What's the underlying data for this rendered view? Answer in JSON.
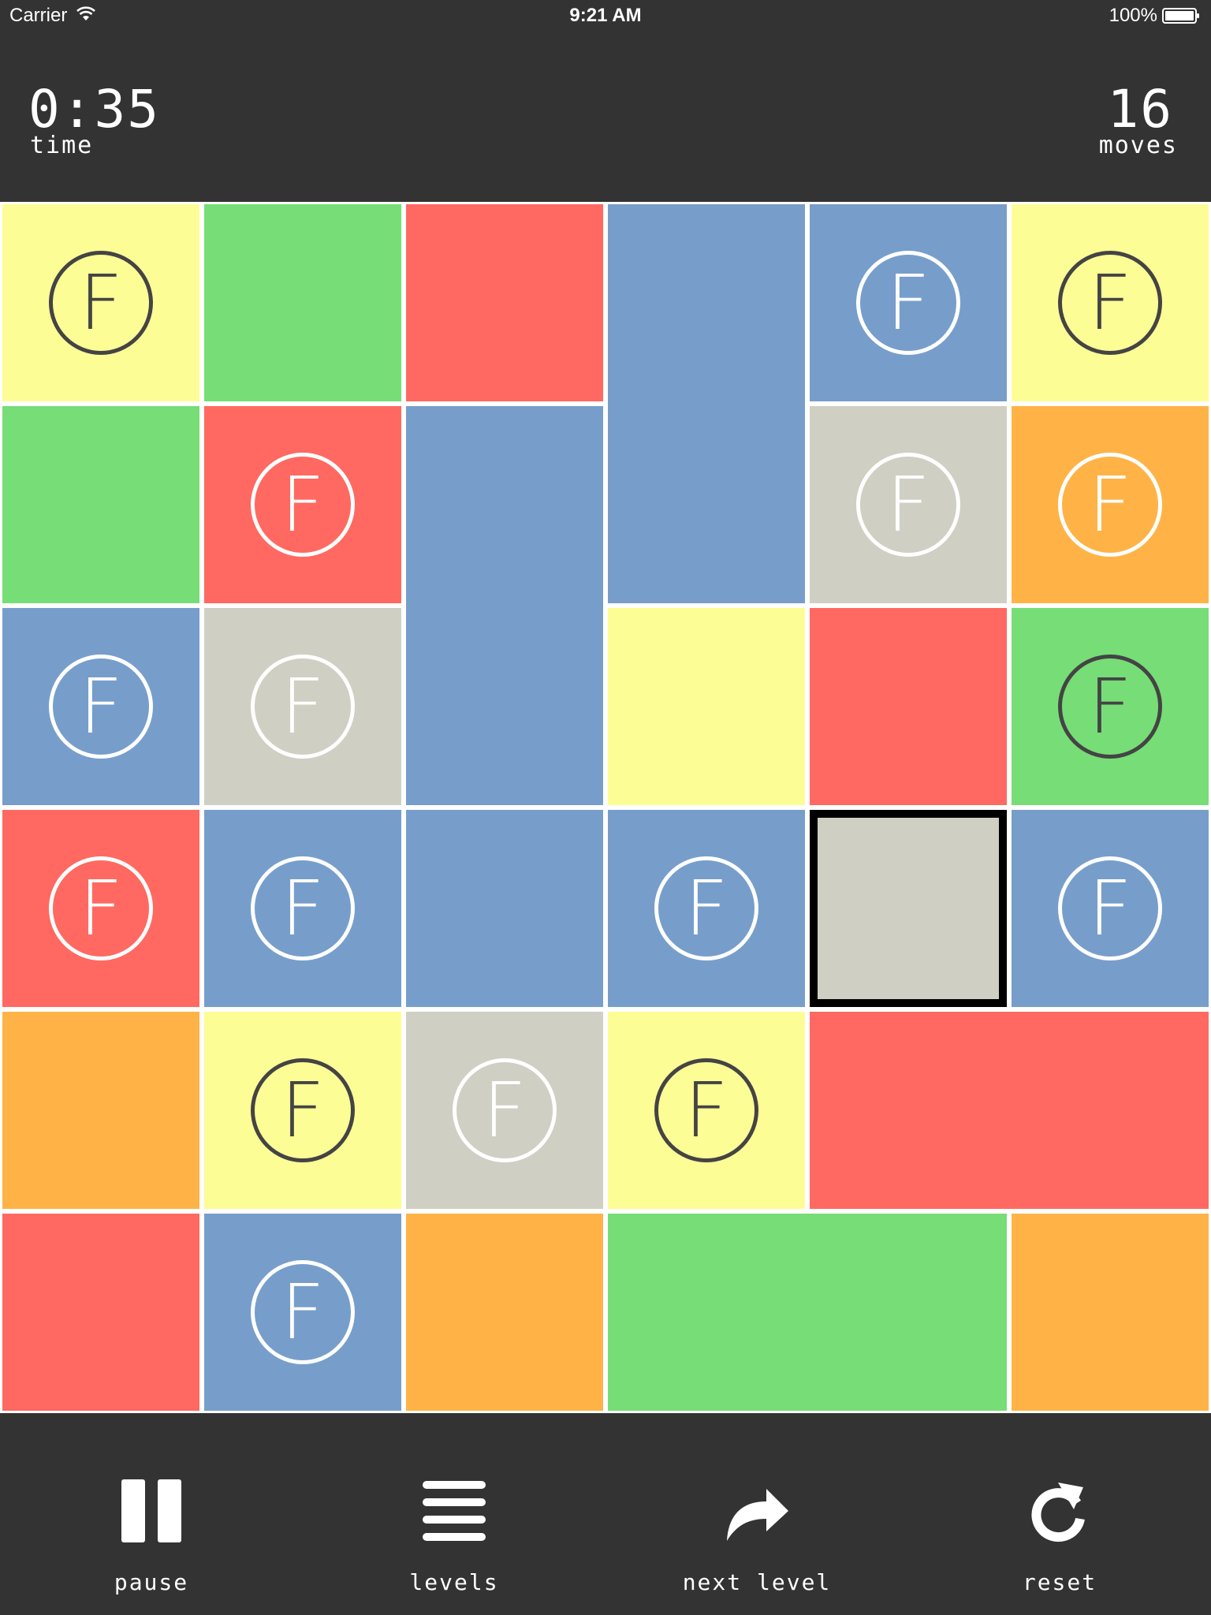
{
  "status_bar": {
    "carrier": "Carrier",
    "time": "9:21 AM",
    "battery": "100%"
  },
  "hud": {
    "time_value": "0:35",
    "time_label": "time",
    "moves_value": "16",
    "moves_label": "moves"
  },
  "board": {
    "columns": 6,
    "rows": 6,
    "colors": {
      "yellow": "#fdfd96",
      "green": "#77dd77",
      "red": "#ff6961",
      "blue": "#779ecb",
      "grey": "#cfcfc4",
      "orange": "#ffb347"
    },
    "badge_glyph": "F",
    "tiles": [
      {
        "id": "r0c0",
        "col": 0,
        "row": 0,
        "w": 1,
        "h": 1,
        "color": "yellow",
        "badge": true
      },
      {
        "id": "r0c1",
        "col": 1,
        "row": 0,
        "w": 1,
        "h": 1,
        "color": "green",
        "badge": false
      },
      {
        "id": "r0c2",
        "col": 2,
        "row": 0,
        "w": 1,
        "h": 1,
        "color": "red",
        "badge": false
      },
      {
        "id": "r0c3",
        "col": 3,
        "row": 0,
        "w": 1,
        "h": 2,
        "color": "blue",
        "badge": false
      },
      {
        "id": "r0c4",
        "col": 4,
        "row": 0,
        "w": 1,
        "h": 1,
        "color": "blue",
        "badge": true
      },
      {
        "id": "r0c5",
        "col": 5,
        "row": 0,
        "w": 1,
        "h": 1,
        "color": "yellow",
        "badge": true
      },
      {
        "id": "r1c0",
        "col": 0,
        "row": 1,
        "w": 1,
        "h": 1,
        "color": "green",
        "badge": false
      },
      {
        "id": "r1c1",
        "col": 1,
        "row": 1,
        "w": 1,
        "h": 1,
        "color": "red",
        "badge": true
      },
      {
        "id": "r1c2",
        "col": 2,
        "row": 1,
        "w": 1,
        "h": 2,
        "color": "blue",
        "badge": false
      },
      {
        "id": "r1c4",
        "col": 4,
        "row": 1,
        "w": 1,
        "h": 1,
        "color": "grey",
        "badge": true
      },
      {
        "id": "r1c5",
        "col": 5,
        "row": 1,
        "w": 1,
        "h": 1,
        "color": "orange",
        "badge": true
      },
      {
        "id": "r2c0",
        "col": 0,
        "row": 2,
        "w": 1,
        "h": 1,
        "color": "blue",
        "badge": true
      },
      {
        "id": "r2c1",
        "col": 1,
        "row": 2,
        "w": 1,
        "h": 1,
        "color": "grey",
        "badge": true
      },
      {
        "id": "r2c3",
        "col": 3,
        "row": 2,
        "w": 1,
        "h": 1,
        "color": "yellow",
        "badge": false
      },
      {
        "id": "r2c4",
        "col": 4,
        "row": 2,
        "w": 1,
        "h": 1,
        "color": "red",
        "badge": false
      },
      {
        "id": "r2c5",
        "col": 5,
        "row": 2,
        "w": 1,
        "h": 1,
        "color": "green",
        "badge": true
      },
      {
        "id": "r3c0",
        "col": 0,
        "row": 3,
        "w": 1,
        "h": 1,
        "color": "red",
        "badge": true
      },
      {
        "id": "r3c1",
        "col": 1,
        "row": 3,
        "w": 1,
        "h": 1,
        "color": "blue",
        "badge": true
      },
      {
        "id": "r3c2",
        "col": 2,
        "row": 3,
        "w": 1,
        "h": 1,
        "color": "blue",
        "badge": false
      },
      {
        "id": "r3c3",
        "col": 3,
        "row": 3,
        "w": 1,
        "h": 1,
        "color": "blue",
        "badge": true
      },
      {
        "id": "r3c4",
        "col": 4,
        "row": 3,
        "w": 1,
        "h": 1,
        "color": "grey",
        "badge": false,
        "selected": true
      },
      {
        "id": "r3c5",
        "col": 5,
        "row": 3,
        "w": 1,
        "h": 1,
        "color": "blue",
        "badge": true
      },
      {
        "id": "r4c0",
        "col": 0,
        "row": 4,
        "w": 1,
        "h": 1,
        "color": "orange",
        "badge": false
      },
      {
        "id": "r4c1",
        "col": 1,
        "row": 4,
        "w": 1,
        "h": 1,
        "color": "yellow",
        "badge": true
      },
      {
        "id": "r4c2",
        "col": 2,
        "row": 4,
        "w": 1,
        "h": 1,
        "color": "grey",
        "badge": true
      },
      {
        "id": "r4c3",
        "col": 3,
        "row": 4,
        "w": 1,
        "h": 1,
        "color": "yellow",
        "badge": true
      },
      {
        "id": "r4c4",
        "col": 4,
        "row": 4,
        "w": 2,
        "h": 1,
        "color": "red",
        "badge": false
      },
      {
        "id": "r5c0",
        "col": 0,
        "row": 5,
        "w": 1,
        "h": 1,
        "color": "red",
        "badge": false
      },
      {
        "id": "r5c1",
        "col": 1,
        "row": 5,
        "w": 1,
        "h": 1,
        "color": "blue",
        "badge": true
      },
      {
        "id": "r5c2",
        "col": 2,
        "row": 5,
        "w": 1,
        "h": 1,
        "color": "orange",
        "badge": false
      },
      {
        "id": "r5c3",
        "col": 3,
        "row": 5,
        "w": 2,
        "h": 1,
        "color": "green",
        "badge": false
      },
      {
        "id": "r5c5",
        "col": 5,
        "row": 5,
        "w": 1,
        "h": 1,
        "color": "orange",
        "badge": false
      }
    ]
  },
  "toolbar": {
    "pause_label": "pause",
    "levels_label": "levels",
    "next_label": "next level",
    "reset_label": "reset",
    "icons": [
      "pause-icon",
      "levels-icon",
      "next-level-icon",
      "reset-icon"
    ]
  }
}
